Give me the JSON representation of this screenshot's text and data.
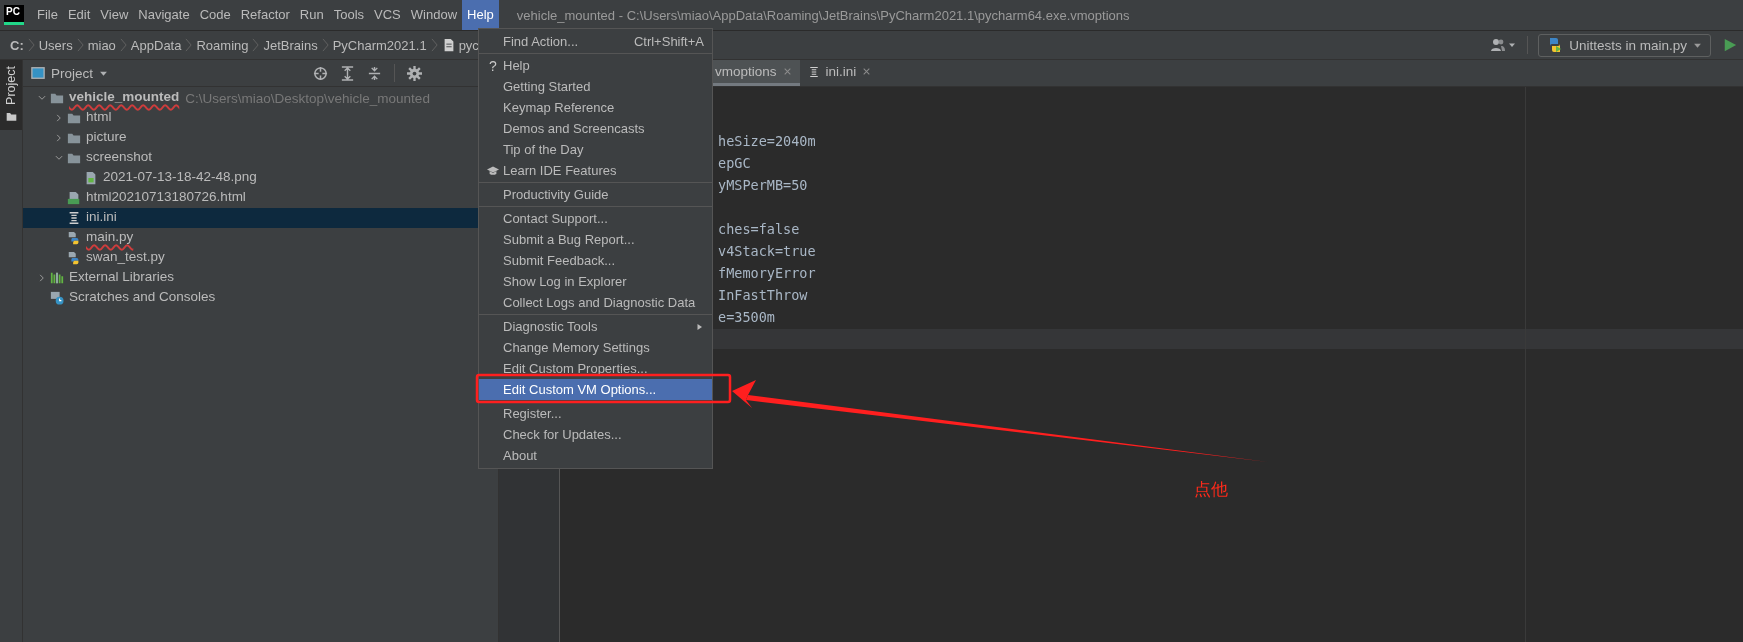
{
  "menu_bar": {
    "logo": "PC",
    "menus": [
      {
        "label": "File",
        "selected": false
      },
      {
        "label": "Edit",
        "selected": false
      },
      {
        "label": "View",
        "selected": false
      },
      {
        "label": "Navigate",
        "selected": false
      },
      {
        "label": "Code",
        "selected": false
      },
      {
        "label": "Refactor",
        "selected": false
      },
      {
        "label": "Run",
        "selected": false
      },
      {
        "label": "Tools",
        "selected": false
      },
      {
        "label": "VCS",
        "selected": false
      },
      {
        "label": "Window",
        "selected": false
      },
      {
        "label": "Help",
        "selected": true
      }
    ],
    "title": "vehicle_mounted - C:\\Users\\miao\\AppData\\Roaming\\JetBrains\\PyCharm2021.1\\pycharm64.exe.vmoptions"
  },
  "breadcrumbs": [
    {
      "label": "C:",
      "kind": "drive"
    },
    {
      "label": "Users",
      "kind": "folder"
    },
    {
      "label": "miao",
      "kind": "folder"
    },
    {
      "label": "AppData",
      "kind": "folder"
    },
    {
      "label": "Roaming",
      "kind": "folder"
    },
    {
      "label": "JetBrains",
      "kind": "folder"
    },
    {
      "label": "PyCharm2021.1",
      "kind": "folder"
    },
    {
      "label": "pyc",
      "kind": "file"
    }
  ],
  "run_config": {
    "label": "Unittests in main.py"
  },
  "side_strip": {
    "label": "Project",
    "selected": true
  },
  "project_panel": {
    "title": "Project",
    "tree": [
      {
        "name": "vehicle_mounted",
        "kind": "root",
        "path": "C:\\Users\\miao\\Desktop\\vehicle_mounted",
        "expanded": true,
        "selected": false,
        "spell_error": true,
        "children": [
          {
            "name": "html",
            "kind": "folder",
            "expanded": false,
            "selected": false,
            "spell_error": false
          },
          {
            "name": "picture",
            "kind": "folder",
            "expanded": false,
            "selected": false,
            "spell_error": false
          },
          {
            "name": "screenshot",
            "kind": "folder",
            "expanded": true,
            "selected": false,
            "spell_error": false,
            "children": [
              {
                "name": "2021-07-13-18-42-48.png",
                "kind": "image",
                "selected": false,
                "spell_error": false
              }
            ]
          },
          {
            "name": "html20210713180726.html",
            "kind": "html",
            "selected": false,
            "spell_error": false
          },
          {
            "name": "ini.ini",
            "kind": "ini",
            "selected": true,
            "spell_error": false
          },
          {
            "name": "main.py",
            "kind": "python",
            "selected": false,
            "spell_error": true
          },
          {
            "name": "swan_test.py",
            "kind": "python",
            "selected": false,
            "spell_error": false
          }
        ]
      },
      {
        "name": "External Libraries",
        "kind": "library",
        "expanded": false,
        "selected": false,
        "spell_error": false
      },
      {
        "name": "Scratches and Consoles",
        "kind": "scratch",
        "selected": false,
        "spell_error": false
      }
    ]
  },
  "editor": {
    "tabs": [
      {
        "label": "vmoptions",
        "kind": "config",
        "selected": true
      },
      {
        "label": "ini.ini",
        "kind": "ini",
        "selected": false
      }
    ],
    "lines": [
      {
        "kind": "blank",
        "current": false
      },
      {
        "kind": "blank",
        "current": false
      },
      {
        "kind": "code",
        "text": "heSize=2040m",
        "current": false
      },
      {
        "kind": "code",
        "text": "epGC",
        "current": false
      },
      {
        "kind": "code",
        "text": "yMSPerMB=50",
        "current": false
      },
      {
        "kind": "blank",
        "current": false
      },
      {
        "kind": "code",
        "text": "ches=false",
        "current": false
      },
      {
        "kind": "code",
        "text": "v4Stack=true",
        "current": false
      },
      {
        "kind": "code",
        "text": "fMemoryError",
        "current": false
      },
      {
        "kind": "code",
        "text": "InFastThrow",
        "current": false
      },
      {
        "kind": "code",
        "text": "e=3500m",
        "current": false
      },
      {
        "kind": "blank",
        "current": true
      }
    ]
  },
  "help_menu": [
    {
      "kind": "action",
      "label": "Find Action...",
      "shortcut": "Ctrl+Shift+A",
      "selected": false
    },
    {
      "kind": "separator"
    },
    {
      "kind": "action",
      "glyph": "?",
      "label": "Help",
      "selected": false
    },
    {
      "kind": "action",
      "label": "Getting Started",
      "selected": false
    },
    {
      "kind": "action",
      "label": "Keymap Reference",
      "selected": false
    },
    {
      "kind": "action",
      "label": "Demos and Screencasts",
      "selected": false
    },
    {
      "kind": "action",
      "label": "Tip of the Day",
      "selected": false
    },
    {
      "kind": "learn",
      "label": "Learn IDE Features",
      "selected": false
    },
    {
      "kind": "separator"
    },
    {
      "kind": "action",
      "label": "Productivity Guide",
      "selected": false
    },
    {
      "kind": "separator"
    },
    {
      "kind": "action",
      "label": "Contact Support...",
      "selected": false
    },
    {
      "kind": "action",
      "label": "Submit a Bug Report...",
      "selected": false
    },
    {
      "kind": "action",
      "label": "Submit Feedback...",
      "selected": false
    },
    {
      "kind": "action",
      "label": "Show Log in Explorer",
      "selected": false
    },
    {
      "kind": "action",
      "label": "Collect Logs and Diagnostic Data",
      "selected": false
    },
    {
      "kind": "separator"
    },
    {
      "kind": "submenu",
      "label": "Diagnostic Tools",
      "selected": false
    },
    {
      "kind": "action",
      "label": "Change Memory Settings",
      "selected": false
    },
    {
      "kind": "action",
      "label": "Edit Custom Properties...",
      "selected": false
    },
    {
      "kind": "action",
      "label": "Edit Custom VM Options...",
      "selected": true
    },
    {
      "kind": "separator"
    },
    {
      "kind": "action",
      "label": "Register...",
      "selected": false
    },
    {
      "kind": "action",
      "label": "Check for Updates...",
      "selected": false
    },
    {
      "kind": "action",
      "label": "About",
      "selected": false
    }
  ],
  "annotation": {
    "label": "点他"
  }
}
